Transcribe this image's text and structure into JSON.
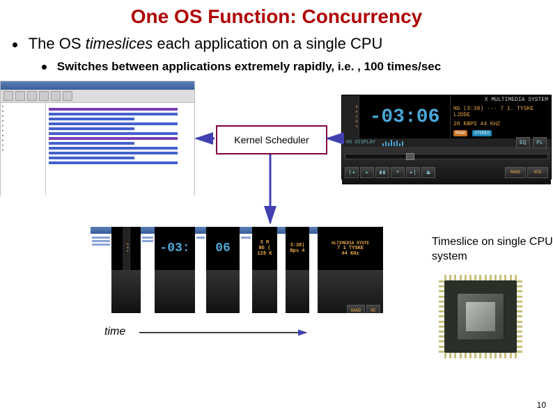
{
  "title": "One OS Function: Concurrency",
  "bullet1_pre": "The OS ",
  "bullet1_em": "timeslices",
  "bullet1_post": " each application on a single CPU",
  "bullet2": "Switches between applications extremely rapidly, i.e. , 100 times/sec",
  "scheduler": "Kernel Scheduler",
  "player": {
    "brand": "X MULTIMEDIA SYSTEM",
    "time": "-03:06",
    "track": "NG (3:38)  ···   7 1.  TYSKE LJDDE",
    "rate": "28 KBPS   44 KHZ",
    "badge1": "MONO",
    "badge2": "STEREO",
    "eq": "EQ",
    "pl": "PL",
    "no_disp": "NO DISPLAY",
    "rand": "RAND",
    "xfd": "XFD"
  },
  "strip_frag_brand": "X M",
  "strip_frag_track1": "NG (",
  "strip_frag_track2": "3:38)",
  "strip_frag_rate1": "128 K",
  "strip_frag_rate2": "Bps  4",
  "strip_frag_brand2": "ULTIMEDIA SYSTE",
  "strip_frag_track3": "7 1   TYSKE",
  "strip_frag_rate3": "44 KHz",
  "strip_frag_06": "06",
  "strip_frag_03": "-03:",
  "strip_rand": "RAND",
  "strip_rf": "RE",
  "timeslice_label": "Timeslice on single CPU system",
  "time_label": "time",
  "page_num": "10"
}
